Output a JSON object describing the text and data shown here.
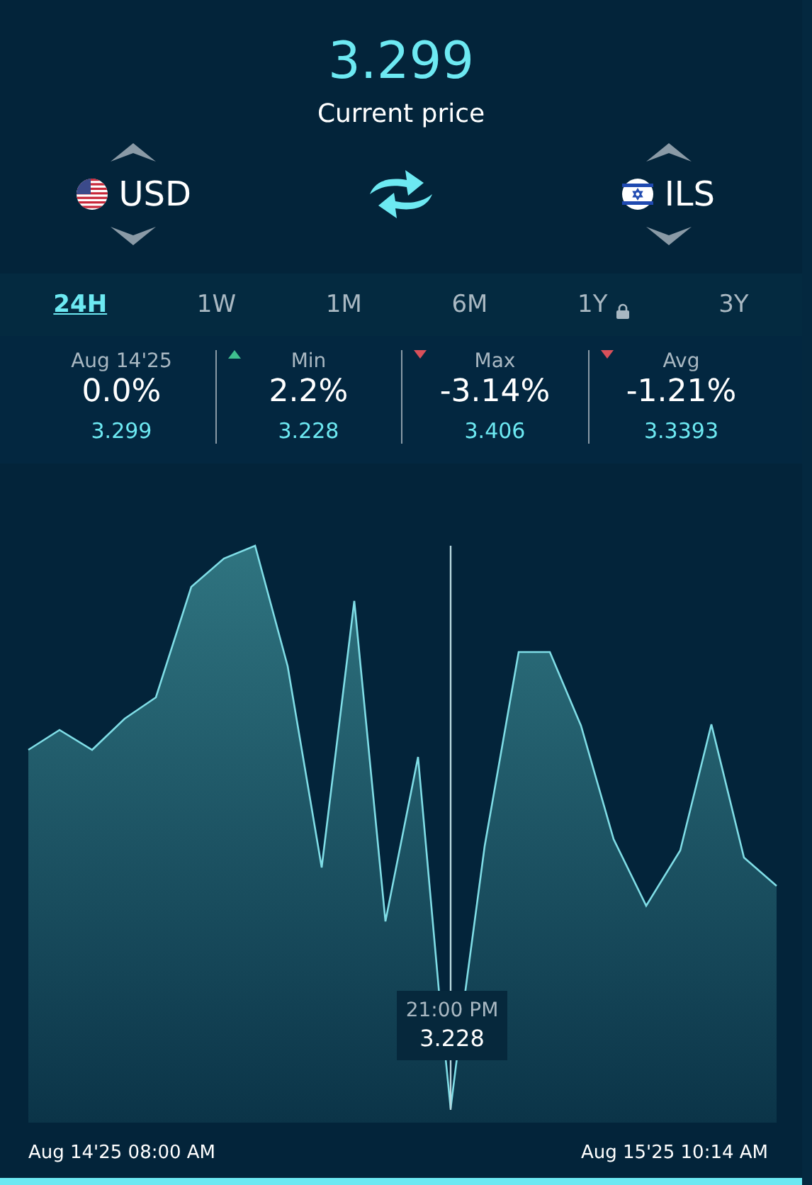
{
  "price": {
    "value": "3.299",
    "label": "Current price"
  },
  "currencies": [
    {
      "code": "USD",
      "kind": "us"
    },
    {
      "code": "ILS",
      "kind": "il"
    }
  ],
  "tabs": [
    {
      "label": "24H",
      "selected": true,
      "locked": false
    },
    {
      "label": "1W",
      "selected": false,
      "locked": false
    },
    {
      "label": "1M",
      "selected": false,
      "locked": false
    },
    {
      "label": "6M",
      "selected": false,
      "locked": false
    },
    {
      "label": "1Y",
      "selected": false,
      "locked": true
    },
    {
      "label": "3Y",
      "selected": false,
      "locked": false
    }
  ],
  "stats": [
    {
      "title": "Aug 14'25",
      "percent": "0.0%",
      "value": "3.299"
    },
    {
      "title": "Min",
      "percent": "2.2%",
      "value": "3.228",
      "color": "#3fbf8f"
    },
    {
      "title": "Max",
      "percent": "-3.14%",
      "value": "3.406",
      "color": "#d9505a"
    },
    {
      "title": "Avg",
      "percent": "-1.21%",
      "value": "3.3393",
      "color": "#d9505a"
    }
  ],
  "chart": {
    "tooltip": {
      "time": "21:00 PM",
      "value": "3.228"
    },
    "start_label": "Aug 14'25 08:00 AM",
    "end_label": "Aug 15'25 10:14 AM"
  }
}
